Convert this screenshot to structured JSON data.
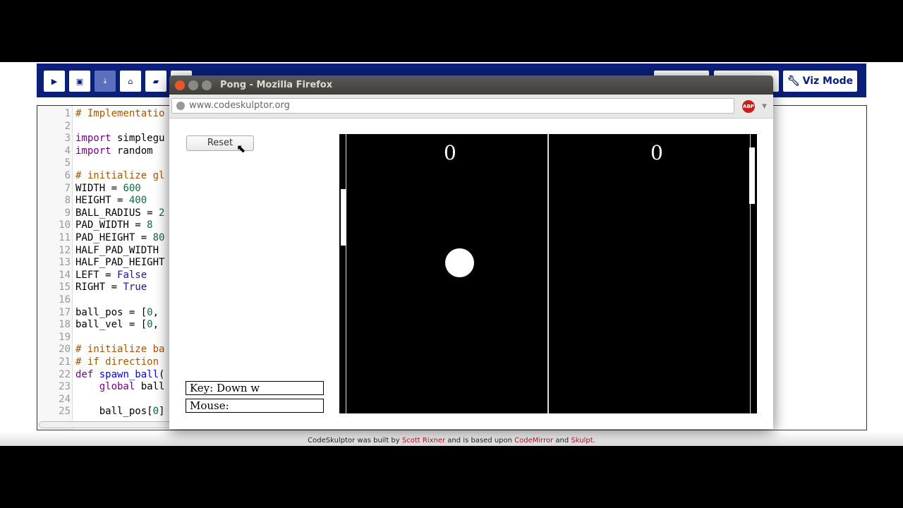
{
  "toolbar": {
    "buttons": [
      "run",
      "save",
      "download",
      "share",
      "open",
      "extra"
    ],
    "viz_mode_label": "Viz Mode",
    "wrench_icon": "wrench-icon"
  },
  "editor": {
    "lines": [
      [
        [
          "comment",
          "# Implementatio"
        ]
      ],
      [],
      [
        [
          "keyword",
          "import"
        ],
        [
          "plain",
          " simplegu"
        ]
      ],
      [
        [
          "keyword",
          "import"
        ],
        [
          "plain",
          " random"
        ]
      ],
      [],
      [
        [
          "comment",
          "# initialize gl"
        ]
      ],
      [
        [
          "plain",
          "WIDTH = "
        ],
        [
          "number",
          "600"
        ]
      ],
      [
        [
          "plain",
          "HEIGHT = "
        ],
        [
          "number",
          "400"
        ]
      ],
      [
        [
          "plain",
          "BALL_RADIUS = "
        ],
        [
          "number",
          "2"
        ]
      ],
      [
        [
          "plain",
          "PAD_WIDTH = "
        ],
        [
          "number",
          "8"
        ]
      ],
      [
        [
          "plain",
          "PAD_HEIGHT = "
        ],
        [
          "number",
          "80"
        ]
      ],
      [
        [
          "plain",
          "HALF_PAD_WIDTH "
        ]
      ],
      [
        [
          "plain",
          "HALF_PAD_HEIGHT"
        ]
      ],
      [
        [
          "plain",
          "LEFT = "
        ],
        [
          "atom",
          "False"
        ]
      ],
      [
        [
          "plain",
          "RIGHT = "
        ],
        [
          "atom",
          "True"
        ]
      ],
      [],
      [
        [
          "plain",
          "ball_pos = ["
        ],
        [
          "number",
          "0"
        ],
        [
          "plain",
          ","
        ]
      ],
      [
        [
          "plain",
          "ball_vel = ["
        ],
        [
          "number",
          "0"
        ],
        [
          "plain",
          ","
        ]
      ],
      [],
      [
        [
          "comment",
          "# initialize ba"
        ]
      ],
      [
        [
          "comment",
          "# if direction "
        ]
      ],
      [
        [
          "keyword",
          "def"
        ],
        [
          "plain",
          " "
        ],
        [
          "def",
          "spawn_ball"
        ],
        [
          "plain",
          "("
        ]
      ],
      [
        [
          "plain",
          "    "
        ],
        [
          "keyword",
          "global"
        ],
        [
          "plain",
          " ball"
        ]
      ],
      [],
      [
        [
          "plain",
          "    ball_pos["
        ],
        [
          "number",
          "0"
        ],
        [
          "plain",
          "]"
        ]
      ]
    ]
  },
  "footer": {
    "prefix": "CodeSkulptor was built by ",
    "author": "Scott Rixner",
    "middle": " and is based upon ",
    "lib1": "CodeMirror",
    "and": " and ",
    "lib2": "Skulpt",
    "end": "."
  },
  "browser": {
    "title": "Pong - Mozilla Firefox",
    "url": "www.codeskulptor.org",
    "abp_label": "ABP"
  },
  "game": {
    "reset_label": "Reset",
    "key_label": "Key: Down w",
    "mouse_label": "Mouse:",
    "score_left": "0",
    "score_right": "0"
  }
}
